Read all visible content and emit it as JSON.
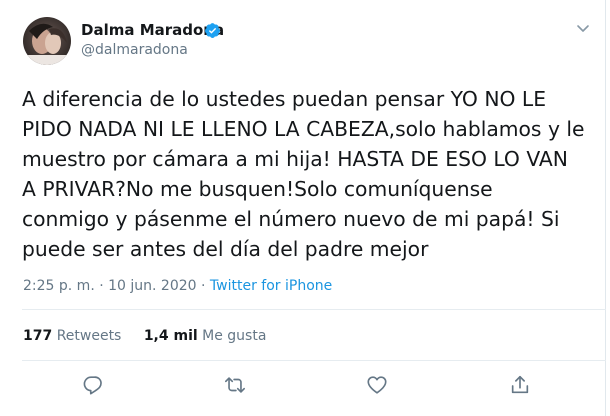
{
  "author": {
    "display_name": "Dalma Maradona",
    "handle": "@dalmaradona",
    "verified": true
  },
  "tweet": {
    "lines": [
      "A diferencia de lo ustedes puedan pensar YO NO LE",
      "PIDO NADA NI LE LLENO LA CABEZA,solo hablamos y le",
      "muestro por cámara a mi hija! HASTA DE ESO LO VAN",
      "A PRIVAR?No me busquen!Solo comuníquense",
      "conmigo y pásenme el número nuevo de mi papá! Si",
      "puede ser antes del día del padre mejor"
    ],
    "time": "2:25 p. m.",
    "separator": "·",
    "date": "10 jun. 2020",
    "source": "Twitter for iPhone"
  },
  "stats": {
    "retweets_count": "177",
    "retweets_label": "Retweets",
    "likes_count": "1,4 mil",
    "likes_label": "Me gusta"
  },
  "icons": {
    "verified": "verified-badge-icon",
    "caret": "chevron-down-icon",
    "reply": "reply-icon",
    "retweet": "retweet-icon",
    "like": "heart-icon",
    "share": "share-icon"
  },
  "colors": {
    "accent": "#1da1f2",
    "text": "#14171a",
    "muted": "#657786",
    "link": "#1b95e0"
  }
}
